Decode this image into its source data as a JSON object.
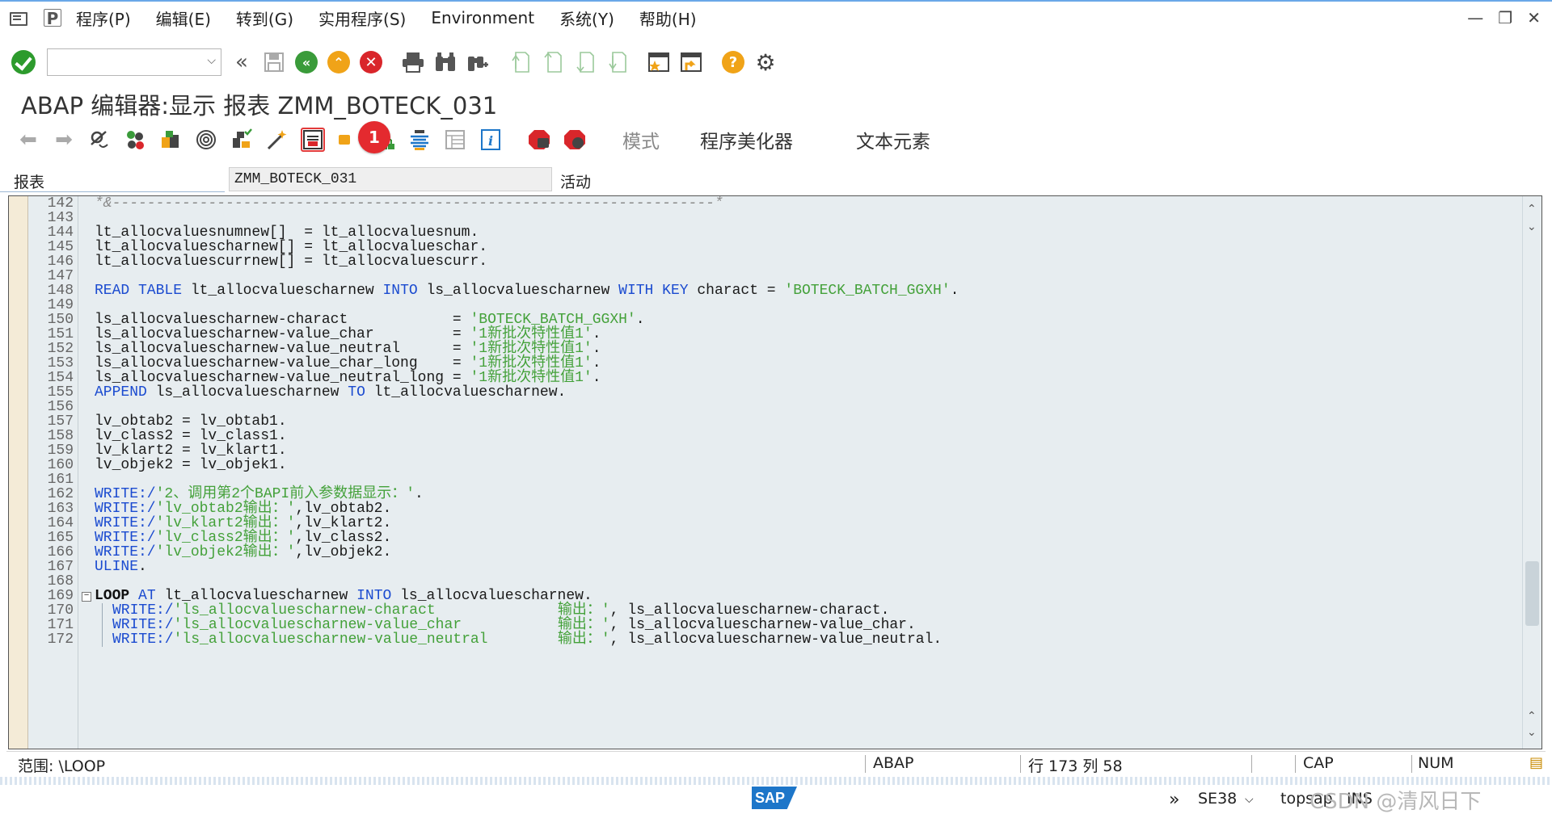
{
  "menubar": {
    "items": [
      "程序(P)",
      "编辑(E)",
      "转到(G)",
      "实用程序(S)",
      "Environment",
      "系统(Y)",
      "帮助(H)"
    ],
    "window_controls": [
      "—",
      "❐",
      "✕"
    ]
  },
  "toolbar": {
    "command_value": "",
    "icons": [
      "enter-icon",
      "back-double-icon",
      "save-icon",
      "back-icon",
      "exit-icon",
      "cancel-icon",
      "print-icon",
      "find-icon",
      "find-next-icon",
      "first-page-icon",
      "prev-page-icon",
      "next-page-icon",
      "last-page-icon",
      "new-session-icon",
      "shortcut-icon",
      "help-icon",
      "settings-icon"
    ]
  },
  "title": "ABAP 编辑器:显示 报表 ZMM_BOTECK_031",
  "app_toolbar": {
    "buttons": [
      "模式",
      "程序美化器",
      "文本元素"
    ],
    "badge": "1"
  },
  "report": {
    "label": "报表",
    "name": "ZMM_BOTECK_031",
    "status": "活动"
  },
  "editor": {
    "lines": [
      {
        "n": "142",
        "parts": [
          [
            "cmt",
            "*&---------------------------------------------------------------------*"
          ]
        ]
      },
      {
        "n": "143",
        "parts": []
      },
      {
        "n": "144",
        "parts": [
          [
            "",
            "lt_allocvaluesnumnew[]  = lt_allocvaluesnum."
          ]
        ]
      },
      {
        "n": "145",
        "parts": [
          [
            "",
            "lt_allocvaluescharnew[] = lt_allocvalueschar."
          ]
        ]
      },
      {
        "n": "146",
        "parts": [
          [
            "",
            "lt_allocvaluescurrnew[] = lt_allocvaluescurr."
          ]
        ]
      },
      {
        "n": "147",
        "parts": []
      },
      {
        "n": "148",
        "parts": [
          [
            "kw",
            "READ TABLE"
          ],
          [
            "",
            " lt_allocvaluescharnew "
          ],
          [
            "kw",
            "INTO"
          ],
          [
            "",
            " ls_allocvaluescharnew "
          ],
          [
            "kw",
            "WITH KEY"
          ],
          [
            "",
            " charact = "
          ],
          [
            "str",
            "'BOTECK_BATCH_GGXH'"
          ],
          [
            "",
            "."
          ]
        ]
      },
      {
        "n": "149",
        "parts": []
      },
      {
        "n": "150",
        "parts": [
          [
            "",
            "ls_allocvaluescharnew-charact            = "
          ],
          [
            "str",
            "'BOTECK_BATCH_GGXH'"
          ],
          [
            "",
            "."
          ]
        ]
      },
      {
        "n": "151",
        "parts": [
          [
            "",
            "ls_allocvaluescharnew-value_char         = "
          ],
          [
            "str",
            "'1新批次特性值1'"
          ],
          [
            "",
            "."
          ]
        ]
      },
      {
        "n": "152",
        "parts": [
          [
            "",
            "ls_allocvaluescharnew-value_neutral      = "
          ],
          [
            "str",
            "'1新批次特性值1'"
          ],
          [
            "",
            "."
          ]
        ]
      },
      {
        "n": "153",
        "parts": [
          [
            "",
            "ls_allocvaluescharnew-value_char_long    = "
          ],
          [
            "str",
            "'1新批次特性值1'"
          ],
          [
            "",
            "."
          ]
        ]
      },
      {
        "n": "154",
        "parts": [
          [
            "",
            "ls_allocvaluescharnew-value_neutral_long = "
          ],
          [
            "str",
            "'1新批次特性值1'"
          ],
          [
            "",
            "."
          ]
        ]
      },
      {
        "n": "155",
        "parts": [
          [
            "kw",
            "APPEND"
          ],
          [
            "",
            " ls_allocvaluescharnew "
          ],
          [
            "kw",
            "TO"
          ],
          [
            "",
            " lt_allocvaluescharnew."
          ]
        ]
      },
      {
        "n": "156",
        "parts": []
      },
      {
        "n": "157",
        "parts": [
          [
            "",
            "lv_obtab2 = lv_obtab1."
          ]
        ]
      },
      {
        "n": "158",
        "parts": [
          [
            "",
            "lv_class2 = lv_class1."
          ]
        ]
      },
      {
        "n": "159",
        "parts": [
          [
            "",
            "lv_klart2 = lv_klart1."
          ]
        ]
      },
      {
        "n": "160",
        "parts": [
          [
            "",
            "lv_objek2 = lv_objek1."
          ]
        ]
      },
      {
        "n": "161",
        "parts": []
      },
      {
        "n": "162",
        "parts": [
          [
            "kw",
            "WRITE:/"
          ],
          [
            "str",
            "'2、调用第2个BAPI前入参数据显示：'"
          ],
          [
            "",
            "."
          ]
        ]
      },
      {
        "n": "163",
        "parts": [
          [
            "kw",
            "WRITE:/"
          ],
          [
            "str",
            "'lv_obtab2输出：'"
          ],
          [
            "",
            ",lv_obtab2."
          ]
        ]
      },
      {
        "n": "164",
        "parts": [
          [
            "kw",
            "WRITE:/"
          ],
          [
            "str",
            "'lv_klart2输出：'"
          ],
          [
            "",
            ",lv_klart2."
          ]
        ]
      },
      {
        "n": "165",
        "parts": [
          [
            "kw",
            "WRITE:/"
          ],
          [
            "str",
            "'lv_class2输出：'"
          ],
          [
            "",
            ",lv_class2."
          ]
        ]
      },
      {
        "n": "166",
        "parts": [
          [
            "kw",
            "WRITE:/"
          ],
          [
            "str",
            "'lv_objek2输出：'"
          ],
          [
            "",
            ",lv_objek2."
          ]
        ]
      },
      {
        "n": "167",
        "parts": [
          [
            "kw",
            "ULINE"
          ],
          [
            "",
            "."
          ]
        ]
      },
      {
        "n": "168",
        "parts": []
      },
      {
        "n": "169",
        "parts": [
          [
            "kwb",
            "LOOP"
          ],
          [
            "",
            " "
          ],
          [
            "kw",
            "AT"
          ],
          [
            "",
            " lt_allocvaluescharnew "
          ],
          [
            "kw",
            "INTO"
          ],
          [
            "",
            " ls_allocvaluescharnew."
          ]
        ],
        "fold": "⊟"
      },
      {
        "n": "170",
        "parts": [
          [
            "kw",
            "WRITE:/"
          ],
          [
            "str",
            "'ls_allocvaluescharnew-charact              输出：'"
          ],
          [
            "",
            ", ls_allocvaluescharnew-charact."
          ]
        ],
        "indent": true
      },
      {
        "n": "171",
        "parts": [
          [
            "kw",
            "WRITE:/"
          ],
          [
            "str",
            "'ls_allocvaluescharnew-value_char           输出：'"
          ],
          [
            "",
            ", ls_allocvaluescharnew-value_char."
          ]
        ],
        "indent": true
      },
      {
        "n": "172",
        "parts": [
          [
            "kw",
            "WRITE:/"
          ],
          [
            "str",
            "'ls_allocvaluescharnew-value_neutral        输出：'"
          ],
          [
            "",
            ", ls_allocvaluescharnew-value_neutral."
          ]
        ],
        "indent": true
      }
    ]
  },
  "statusbar": {
    "scope": "范围: \\LOOP",
    "language": "ABAP",
    "position": "行 173 列  58",
    "cap": "CAP",
    "num": "NUM"
  },
  "footer": {
    "logo": "SAP",
    "transaction": "SE38",
    "server": "topsap",
    "mode": "INS",
    "watermark": "CSDN @清风日下"
  },
  "colors": {
    "keyword": "#1b4bd0",
    "string": "#44a13a",
    "editor_bg": "#e7edf0",
    "badge": "#e42a2f"
  }
}
